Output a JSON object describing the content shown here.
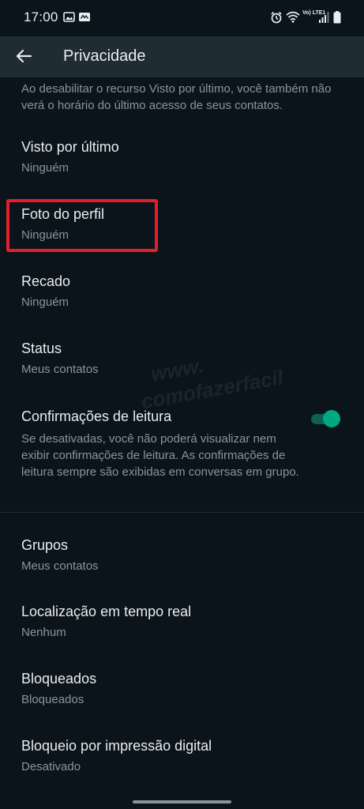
{
  "status_bar": {
    "time": "17:00",
    "network_label": "Vo) LTE1"
  },
  "header": {
    "title": "Privacidade"
  },
  "info_text": "Ao desabilitar o recurso Visto por último, você também não verá o horário do último acesso de seus contatos.",
  "settings": [
    {
      "title": "Visto por último",
      "value": "Ninguém"
    },
    {
      "title": "Foto do perfil",
      "value": "Ninguém"
    },
    {
      "title": "Recado",
      "value": "Ninguém"
    },
    {
      "title": "Status",
      "value": "Meus contatos"
    },
    {
      "title": "Confirmações de leitura",
      "description": "Se desativadas, você não poderá visualizar nem exibir confirmações de leitura. As confirmações de leitura sempre são exibidas em conversas em grupo.",
      "enabled": true
    },
    {
      "title": "Grupos",
      "value": "Meus contatos"
    },
    {
      "title": "Localização em tempo real",
      "value": "Nenhum"
    },
    {
      "title": "Bloqueados",
      "value": "Bloqueados"
    },
    {
      "title": "Bloqueio por impressão digital",
      "value": "Desativado"
    }
  ],
  "watermark": {
    "line1": "www.",
    "line2": "comofazerfacil"
  },
  "colors": {
    "background": "#0b141a",
    "app_bar": "#1f2c34",
    "primary_text": "#e9edef",
    "secondary_text": "#8696a0",
    "accent": "#00a884",
    "highlight": "#e3202a"
  },
  "icons": [
    "back-arrow-icon",
    "gallery-icon",
    "notification-icon",
    "alarm-icon",
    "wifi-icon",
    "signal-icon",
    "battery-icon"
  ]
}
